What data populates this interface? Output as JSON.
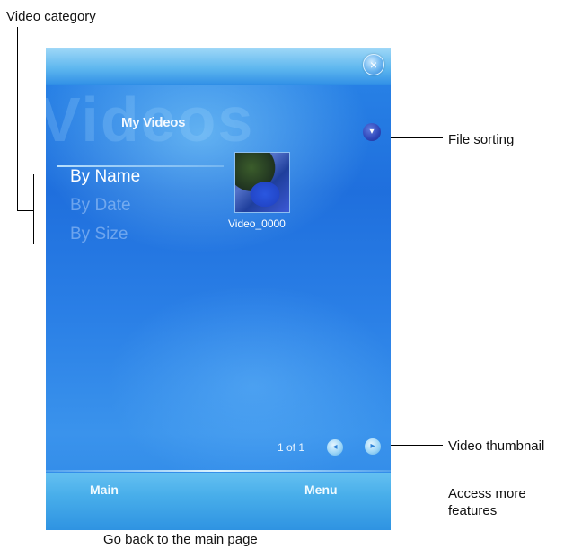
{
  "annotations": {
    "video_category": "Video category",
    "file_sorting": "File sorting",
    "video_thumbnail": "Video thumbnail",
    "access_more": "Access more features",
    "go_back": "Go back to the main page"
  },
  "screen": {
    "title": "My Videos",
    "watermark": "Videos",
    "close_icon": "×",
    "sort_icon": "▾",
    "categories": [
      {
        "label": "By Name",
        "selected": true
      },
      {
        "label": "By Date",
        "selected": false
      },
      {
        "label": "By Size",
        "selected": false
      }
    ],
    "video": {
      "name": "Video_0000"
    },
    "page_indicator": "1 of 1",
    "prev_page_icon": "◂",
    "next_page_icon": "▸",
    "softkeys": {
      "left": "Main",
      "right": "Menu"
    }
  }
}
